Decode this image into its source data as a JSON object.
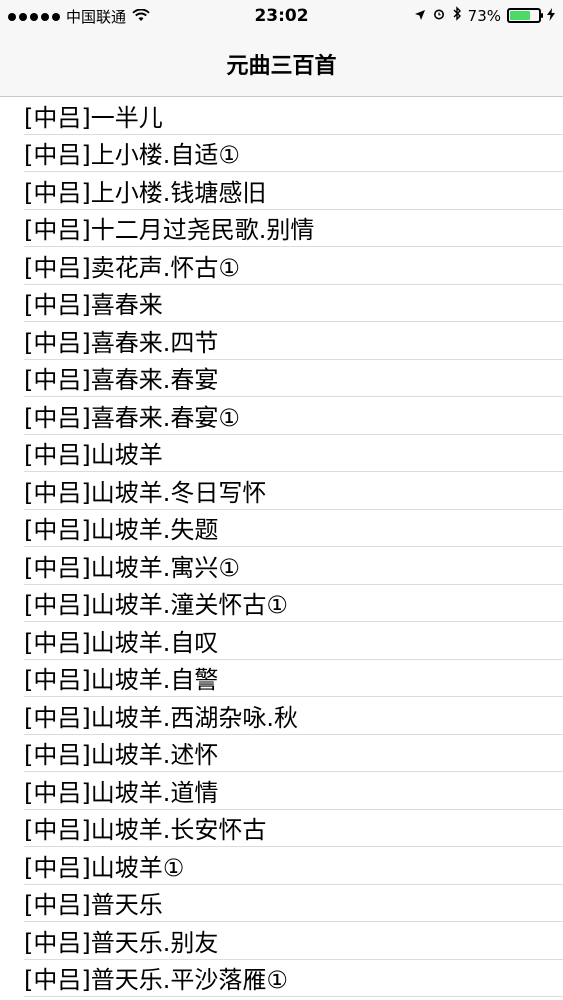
{
  "status_bar": {
    "carrier": "中国联通",
    "time": "23:02",
    "battery_percent": "73%",
    "battery_level": 0.73,
    "wifi_icon": "wifi-icon",
    "location_icon": "location-arrow-icon",
    "alarm_icon": "alarm-icon",
    "bluetooth_icon": "bluetooth-icon",
    "charging_icon": "charging-bolt-icon"
  },
  "nav": {
    "title": "元曲三百首"
  },
  "items": [
    "[中吕]一半儿",
    "[中吕]上小楼.自适①",
    "[中吕]上小楼.钱塘感旧",
    "[中吕]十二月过尧民歌.别情",
    "[中吕]卖花声.怀古①",
    "[中吕]喜春来",
    "[中吕]喜春来.四节",
    "[中吕]喜春来.春宴",
    "[中吕]喜春来.春宴①",
    "[中吕]山坡羊",
    "[中吕]山坡羊.冬日写怀",
    "[中吕]山坡羊.失题",
    "[中吕]山坡羊.寓兴①",
    "[中吕]山坡羊.潼关怀古①",
    "[中吕]山坡羊.自叹",
    "[中吕]山坡羊.自警",
    "[中吕]山坡羊.西湖杂咏.秋",
    "[中吕]山坡羊.述怀",
    "[中吕]山坡羊.道情",
    "[中吕]山坡羊.长安怀古",
    "[中吕]山坡羊①",
    "[中吕]普天乐",
    "[中吕]普天乐.别友",
    "[中吕]普天乐.平沙落雁①"
  ]
}
